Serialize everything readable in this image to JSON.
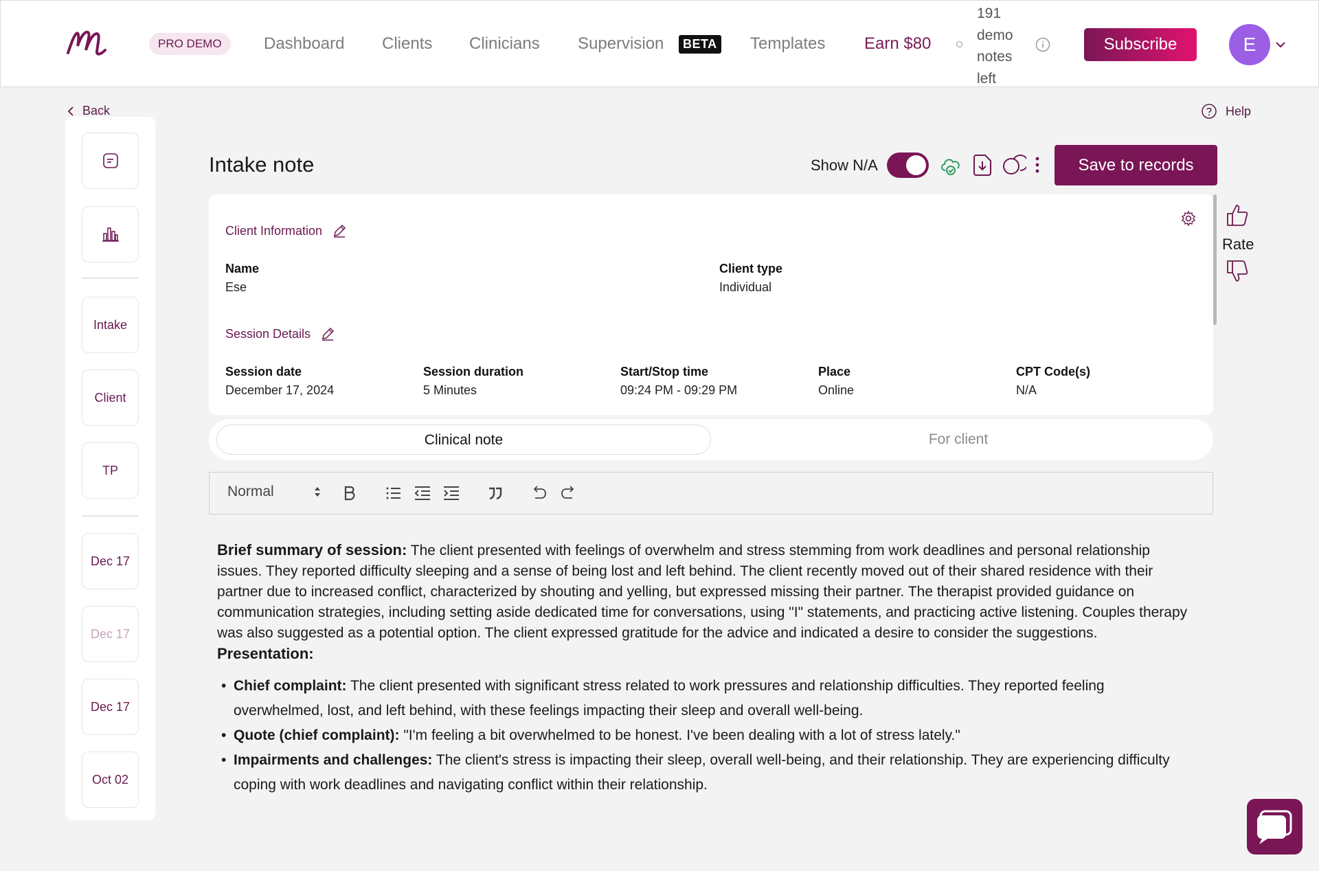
{
  "nav": {
    "badge": "PRO DEMO",
    "links": [
      "Dashboard",
      "Clients",
      "Clinicians",
      "Supervision",
      "Templates"
    ],
    "beta": "BETA",
    "earn": "Earn $80",
    "demo_notes": "191 demo notes left",
    "subscribe": "Subscribe",
    "avatar_initial": "E"
  },
  "back_label": "Back",
  "help_label": "Help",
  "rail": {
    "labels": [
      "Intake",
      "Client",
      "TP"
    ],
    "dates": [
      "Dec 17",
      "Dec 17",
      "Dec 17",
      "Oct 02"
    ]
  },
  "page": {
    "title": "Intake note",
    "show_na": "Show N/A",
    "show_na_on": true,
    "save": "Save to records"
  },
  "client_info": {
    "title": "Client Information",
    "name_label": "Name",
    "name": "Ese",
    "type_label": "Client type",
    "type": "Individual"
  },
  "session": {
    "title": "Session Details",
    "fields": [
      {
        "label": "Session date",
        "value": "December 17, 2024"
      },
      {
        "label": "Session duration",
        "value": "5 Minutes"
      },
      {
        "label": "Start/Stop time",
        "value": "09:24 PM - 09:29 PM"
      },
      {
        "label": "Place",
        "value": "Online"
      },
      {
        "label": "CPT Code(s)",
        "value": "N/A"
      }
    ]
  },
  "rate_label": "Rate",
  "tabs": [
    "Clinical note",
    "For client"
  ],
  "toolbar": {
    "format": "Normal"
  },
  "note": {
    "summary_label": "Brief summary of session:",
    "summary": " The client presented with feelings of overwhelm and stress stemming from work deadlines and personal relationship issues. They reported difficulty sleeping and a sense of being lost and left behind. The client recently moved out of their shared residence with their partner due to increased conflict, characterized by shouting and yelling, but expressed missing their partner. The therapist provided guidance on communication strategies, including setting aside dedicated time for conversations, using \"I\" statements, and practicing active listening. Couples therapy was also suggested as a potential option. The client expressed gratitude for the advice and indicated a desire to consider the suggestions.",
    "presentation_label": "Presentation:",
    "items": [
      {
        "label": "Chief complaint:",
        "text": " The client presented with significant stress related to work pressures and relationship difficulties. They reported feeling overwhelmed, lost, and left behind, with these feelings impacting their sleep and overall well-being."
      },
      {
        "label": "Quote (chief complaint):",
        "text": " \"I'm feeling a bit overwhelmed to be honest. I've been dealing with a lot of stress lately.\""
      },
      {
        "label": "Impairments and challenges:",
        "text": " The client's stress is impacting their sleep, overall well-being, and their relationship. They are experiencing difficulty coping with work deadlines and navigating conflict within their relationship."
      }
    ]
  },
  "colors": {
    "brand": "#7a1656",
    "accent_pink": "#e0136f",
    "avatar": "#9b5fe6",
    "cloud_ok": "#2e9e5e"
  },
  "icons": [
    "logo",
    "info-icon",
    "chevron-down-icon",
    "back-chevron-icon",
    "help-icon",
    "note-icon",
    "chart-icon",
    "pencil-icon",
    "gear-icon",
    "cloud-check-icon",
    "download-icon",
    "copy-icon",
    "more-vertical-icon",
    "thumbs-up-icon",
    "thumbs-down-icon",
    "bold-icon",
    "bullet-list-icon",
    "outdent-icon",
    "indent-icon",
    "quote-icon",
    "undo-icon",
    "redo-icon",
    "chat-icon"
  ]
}
